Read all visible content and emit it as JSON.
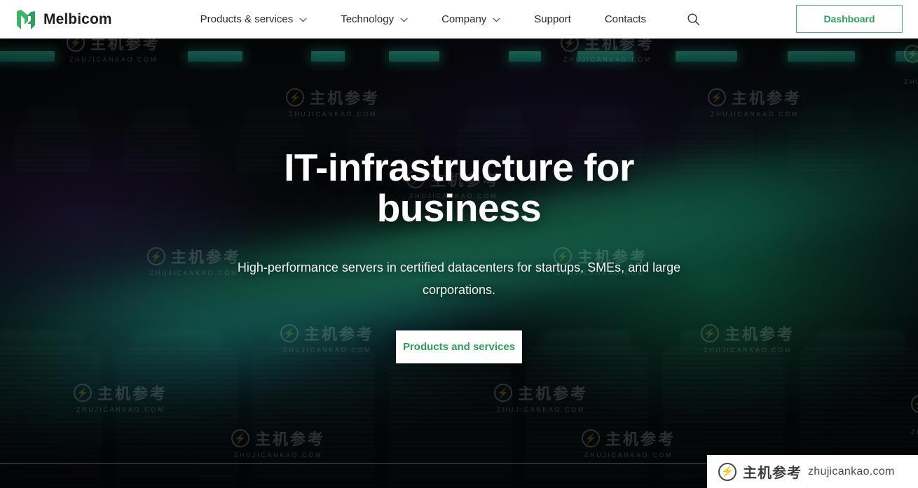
{
  "brand": {
    "name": "Melbicom",
    "logo_icon": "melbicom-m-logo-icon"
  },
  "nav": {
    "items": [
      {
        "label": "Products & services",
        "has_dropdown": true,
        "icon": "chevron-down-icon"
      },
      {
        "label": "Technology",
        "has_dropdown": true,
        "icon": "chevron-down-icon"
      },
      {
        "label": "Company",
        "has_dropdown": true,
        "icon": "chevron-down-icon"
      },
      {
        "label": "Support",
        "has_dropdown": false,
        "icon": ""
      },
      {
        "label": "Contacts",
        "has_dropdown": false,
        "icon": ""
      }
    ],
    "search_icon": "search-icon",
    "dashboard_label": "Dashboard"
  },
  "hero": {
    "title": "IT-infrastructure for business",
    "subtitle": "High-performance servers in certified datacenters for startups, SMEs, and large corporations.",
    "cta_label": "Products and services"
  },
  "watermark": {
    "chinese": "主机参考",
    "url": "ZHUJICANKAO.COM",
    "glyph": "⚡"
  },
  "watermark_bar": {
    "chinese": "主机参考",
    "url": "zhujicankao.com",
    "glyph": "⚡"
  },
  "colors": {
    "accent_green": "#2f9e5f",
    "border_green": "#4cb07a",
    "header_bg": "#ffffff",
    "hero_text": "#ffffff",
    "led_teal": "#3fe0c0"
  }
}
